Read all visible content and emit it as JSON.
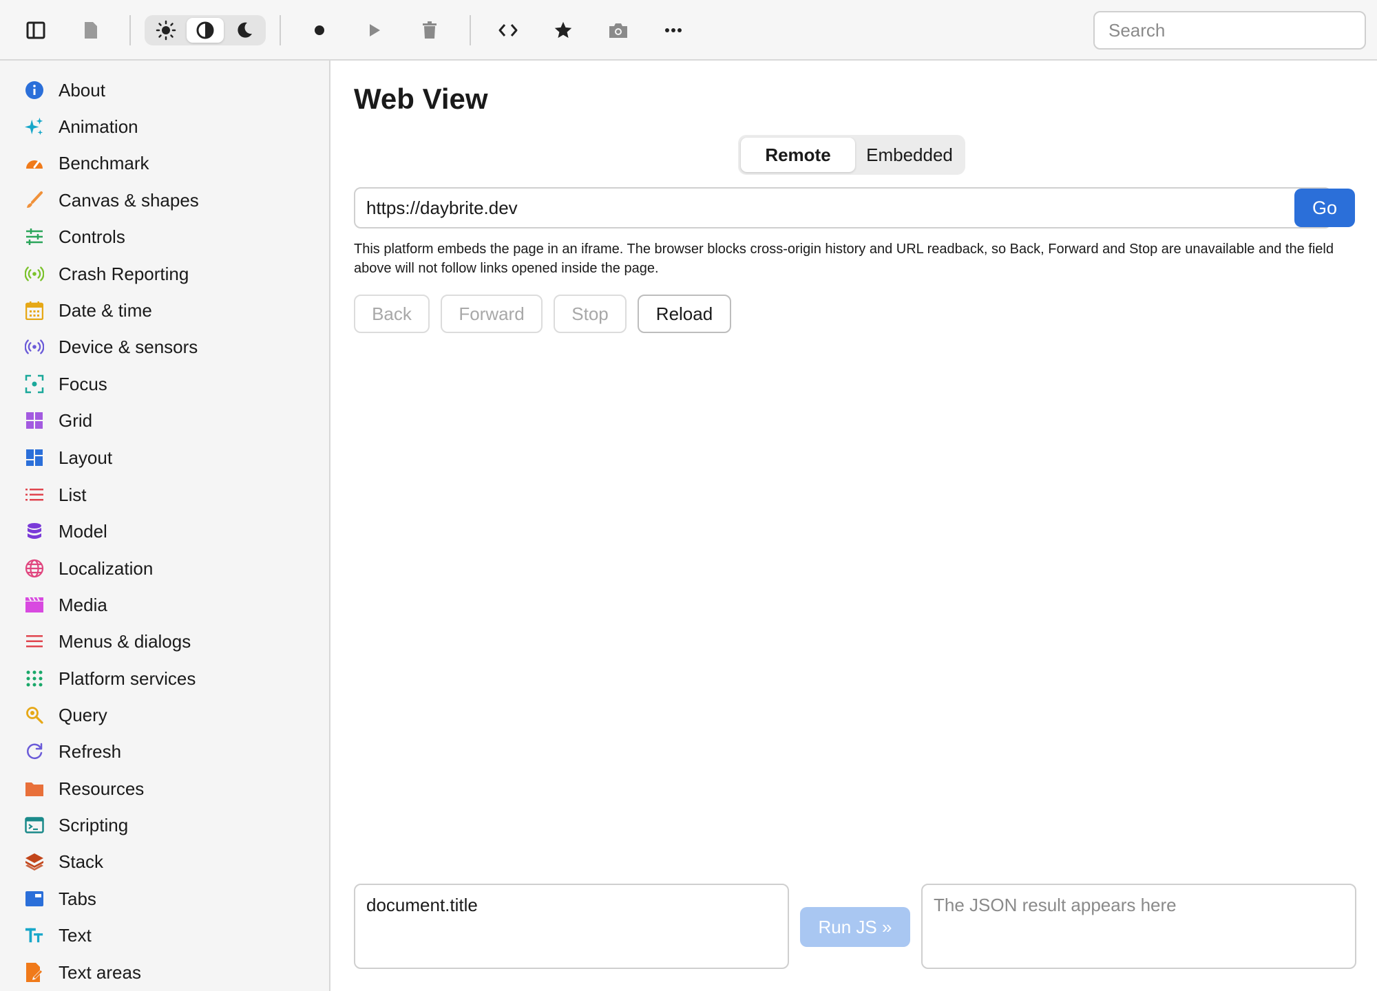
{
  "toolbar": {
    "icons": [
      "sidebar-toggle-icon",
      "file-icon",
      "sun-icon",
      "contrast-icon",
      "moon-icon",
      "record-icon",
      "play-icon",
      "trash-icon",
      "code-icon",
      "star-icon",
      "camera-icon",
      "more-icon"
    ],
    "search_placeholder": "Search"
  },
  "sidebar": {
    "items": [
      {
        "label": "About",
        "icon": "info-icon",
        "color": "#2b6fd9"
      },
      {
        "label": "Animation",
        "icon": "sparkles-icon",
        "color": "#17a7c9"
      },
      {
        "label": "Benchmark",
        "icon": "gauge-icon",
        "color": "#f07a1a"
      },
      {
        "label": "Canvas & shapes",
        "icon": "brush-icon",
        "color": "#f0913a"
      },
      {
        "label": "Controls",
        "icon": "sliders-icon",
        "color": "#2aa55a"
      },
      {
        "label": "Crash Reporting",
        "icon": "broadcast-icon",
        "color": "#7bc22c"
      },
      {
        "label": "Date & time",
        "icon": "calendar-icon",
        "color": "#e6a817"
      },
      {
        "label": "Device & sensors",
        "icon": "sensor-icon",
        "color": "#6a5ad8"
      },
      {
        "label": "Focus",
        "icon": "focus-icon",
        "color": "#1aa89a"
      },
      {
        "label": "Grid",
        "icon": "grid-icon",
        "color": "#a35ae0"
      },
      {
        "label": "Layout",
        "icon": "layout-icon",
        "color": "#2b6fd9"
      },
      {
        "label": "List",
        "icon": "list-icon",
        "color": "#e0454e"
      },
      {
        "label": "Model",
        "icon": "database-icon",
        "color": "#7a3ad8"
      },
      {
        "label": "Localization",
        "icon": "globe-icon",
        "color": "#e0457e"
      },
      {
        "label": "Media",
        "icon": "clapperboard-icon",
        "color": "#d84ae0"
      },
      {
        "label": "Menus & dialogs",
        "icon": "menu-icon",
        "color": "#e0454e"
      },
      {
        "label": "Platform services",
        "icon": "apps-icon",
        "color": "#1aa86a"
      },
      {
        "label": "Query",
        "icon": "search-icon",
        "color": "#e6a817"
      },
      {
        "label": "Refresh",
        "icon": "refresh-icon",
        "color": "#6a5ad8"
      },
      {
        "label": "Resources",
        "icon": "folder-icon",
        "color": "#e8703a"
      },
      {
        "label": "Scripting",
        "icon": "terminal-icon",
        "color": "#1a8a8a"
      },
      {
        "label": "Stack",
        "icon": "layers-icon",
        "color": "#c2451a"
      },
      {
        "label": "Tabs",
        "icon": "tabs-icon",
        "color": "#2b6fd9"
      },
      {
        "label": "Text",
        "icon": "text-icon",
        "color": "#17a7c9"
      },
      {
        "label": "Text areas",
        "icon": "edit-document-icon",
        "color": "#f07a1a"
      }
    ]
  },
  "main": {
    "title": "Web View",
    "modes": [
      "Remote",
      "Embedded"
    ],
    "active_mode": "Remote",
    "url": "https://daybrite.dev",
    "go_label": "Go",
    "note": "This platform embeds the page in an iframe. The browser blocks cross-origin history and URL readback, so Back, Forward and Stop are unavailable and the field above will not follow links opened inside the page.",
    "nav": {
      "back": "Back",
      "forward": "Forward",
      "stop": "Stop",
      "reload": "Reload"
    },
    "js_input": "document.title",
    "run_label": "Run JS »",
    "output_placeholder": "The JSON result appears here"
  },
  "colors": {
    "accent": "#2b6fd9",
    "accent_disabled": "#a9c7f2"
  }
}
